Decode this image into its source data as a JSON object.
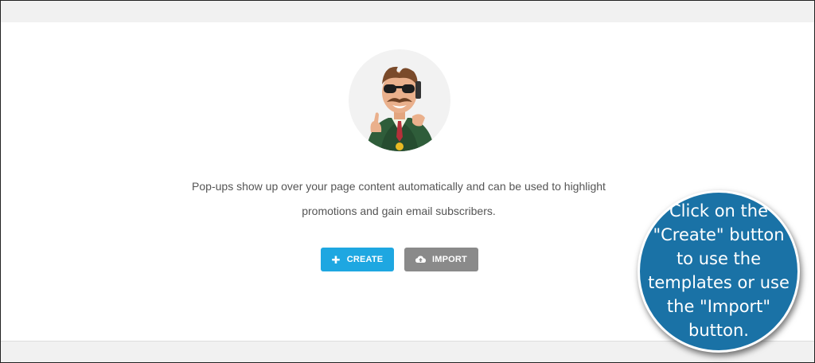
{
  "empty_state": {
    "description_line1": "Pop-ups show up over your page content automatically and can be used to highlight",
    "description_line2": "promotions and gain email subscribers."
  },
  "actions": {
    "create_label": "CREATE",
    "create_icon": "plus-icon",
    "import_label": "IMPORT",
    "import_icon": "cloud-upload-icon"
  },
  "callout": {
    "text_lines": [
      "Click on the",
      "\"Create\" button",
      "to use the",
      "templates or use",
      "the \"Import\"",
      "button."
    ]
  },
  "colors": {
    "create_button": "#1ea7e1",
    "import_button": "#8a8a8a",
    "callout_bg": "#1a72a6",
    "panel_bg": "#ffffff",
    "page_bg": "#f1f1f1"
  }
}
